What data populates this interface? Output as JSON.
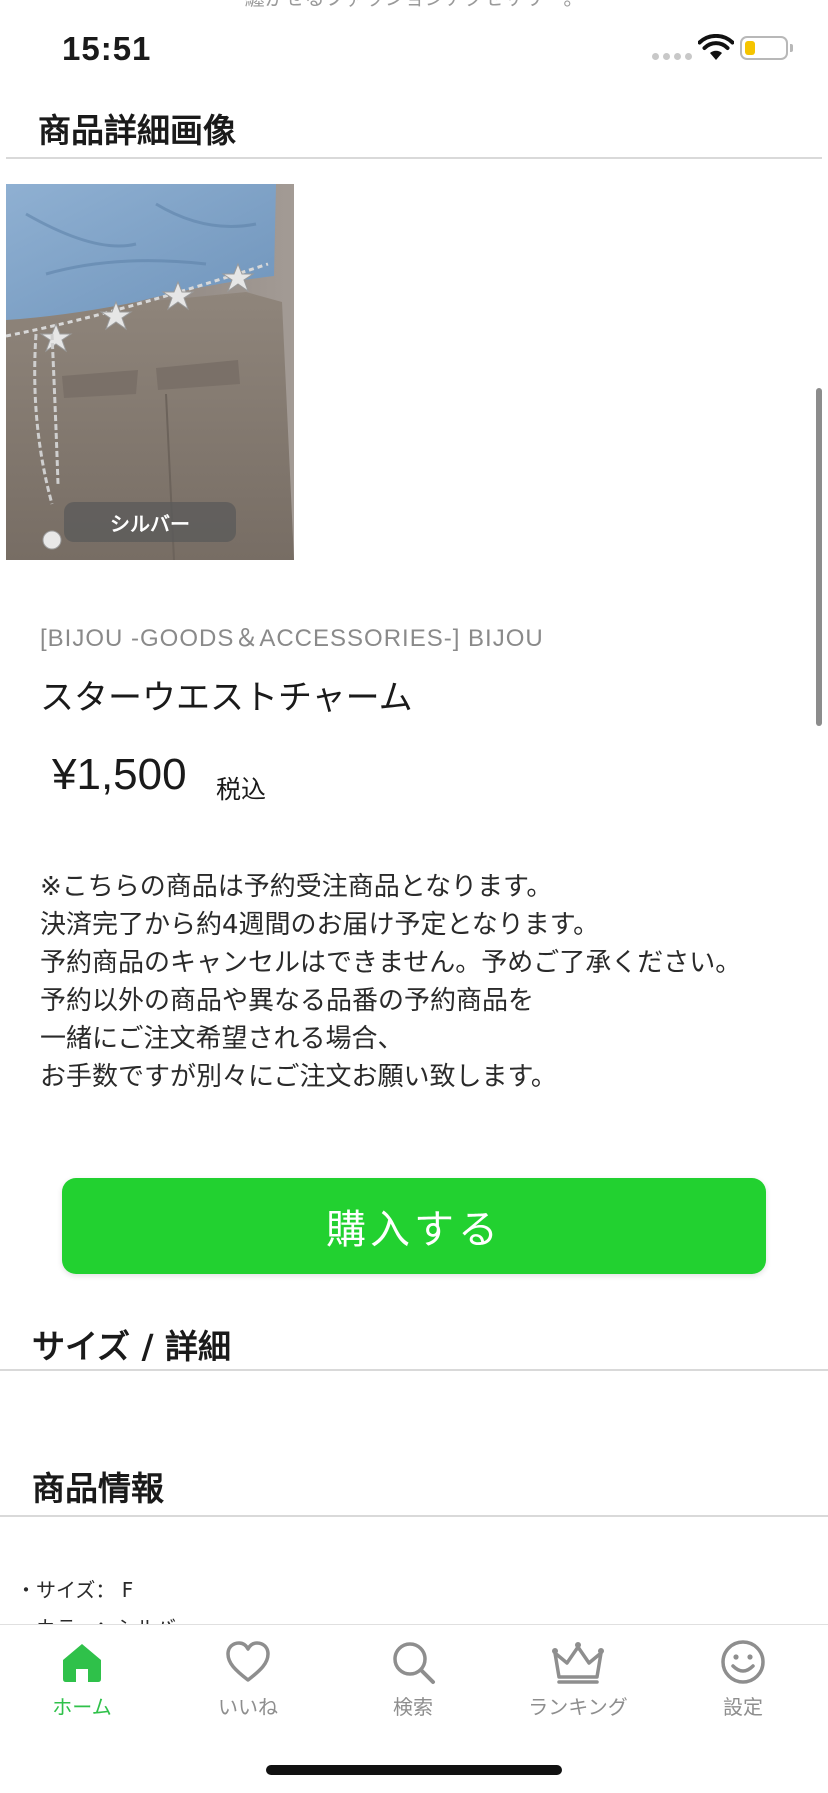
{
  "status_bar": {
    "time": "15:51"
  },
  "top_cutoff_text": "纏かせるファッションアクセサリー。",
  "detail_images": {
    "heading": "商品詳細画像",
    "image_label": "シルバー"
  },
  "product": {
    "brand": "[BIJOU -GOODS＆ACCESSORIES-] BIJOU",
    "name": "スターウエストチャーム",
    "price": "¥1,500",
    "tax_label": "税込",
    "notice": "※こちらの商品は予約受注商品となります。\n決済完了から約4週間のお届け予定となります。\n予約商品のキャンセルはできません。予めご了承ください。\n予約以外の商品や異なる品番の予約商品を\n一緒にご注文希望される場合、\nお手数ですが別々にご注文お願い致します。",
    "buy_label": "購入する"
  },
  "size_section": {
    "heading": "サイズ / 詳細"
  },
  "info_section": {
    "heading": "商品情報",
    "lines": [
      "・サイズ：  F",
      "　カラー：シルバ"
    ]
  },
  "tab_bar": {
    "items": [
      {
        "label": "ホーム",
        "icon": "home-icon",
        "active": true
      },
      {
        "label": "いいね",
        "icon": "heart-icon",
        "active": false
      },
      {
        "label": "検索",
        "icon": "search-icon",
        "active": false
      },
      {
        "label": "ランキング",
        "icon": "crown-icon",
        "active": false
      },
      {
        "label": "設定",
        "icon": "smiley-icon",
        "active": false
      }
    ]
  },
  "colors": {
    "accent_green": "#22d130",
    "tab_active": "#2fc14a",
    "tab_inactive": "#8e8e8e",
    "battery": "#f5c400"
  }
}
